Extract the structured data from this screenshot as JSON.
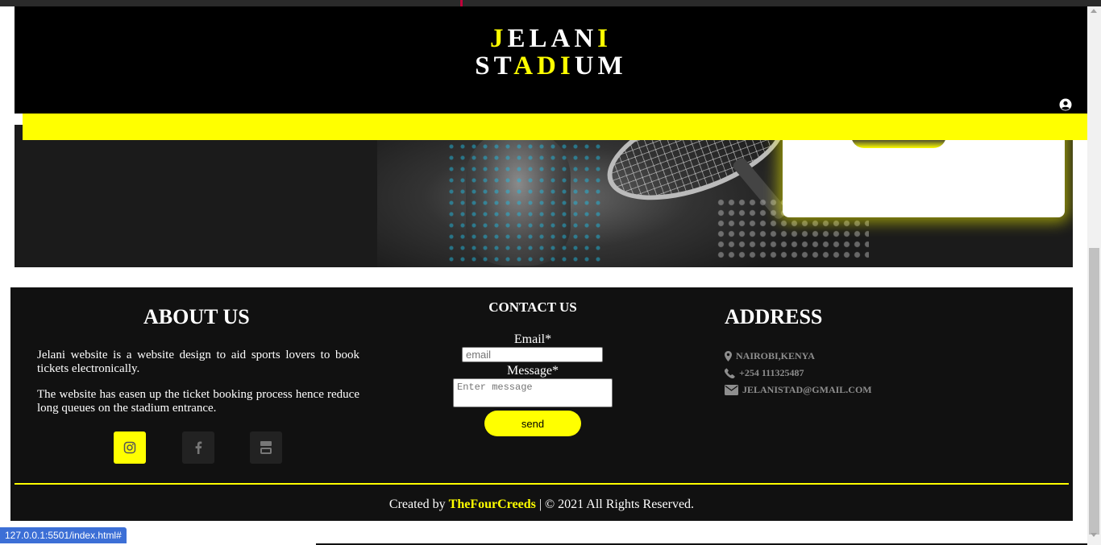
{
  "header": {
    "logo_line1_a": "J",
    "logo_line1_b": "ELAN",
    "logo_line1_c": "I",
    "logo_line2_a": "ST",
    "logo_line2_b": "ADI",
    "logo_line2_c": "UM",
    "accent_color": "#ffff00"
  },
  "about": {
    "title": "ABOUT US",
    "para1": "Jelani website is a website design to aid sports lovers to book tickets electronically.",
    "para2": "The website has easen up the ticket booking process hence reduce long queues on the stadium entrance.",
    "social": [
      "instagram-icon",
      "facebook-icon",
      "youtube-icon"
    ]
  },
  "contact": {
    "title": "CONTACT US",
    "email_label": "Email*",
    "email_placeholder": "email",
    "message_label": "Message*",
    "message_placeholder": "Enter message",
    "send_label": "send"
  },
  "address": {
    "title": "ADDRESS",
    "location": "NAIROBI,KENYA",
    "phone": "+254 111325487",
    "email": "JELANISTAD@GMAIL.COM"
  },
  "footer": {
    "created_by": "Created by",
    "brand": "TheFourCreeds",
    "rights": "| © 2021 All Rights Reserved."
  },
  "status_bar": {
    "url": "127.0.0.1:5501/index.html#"
  }
}
